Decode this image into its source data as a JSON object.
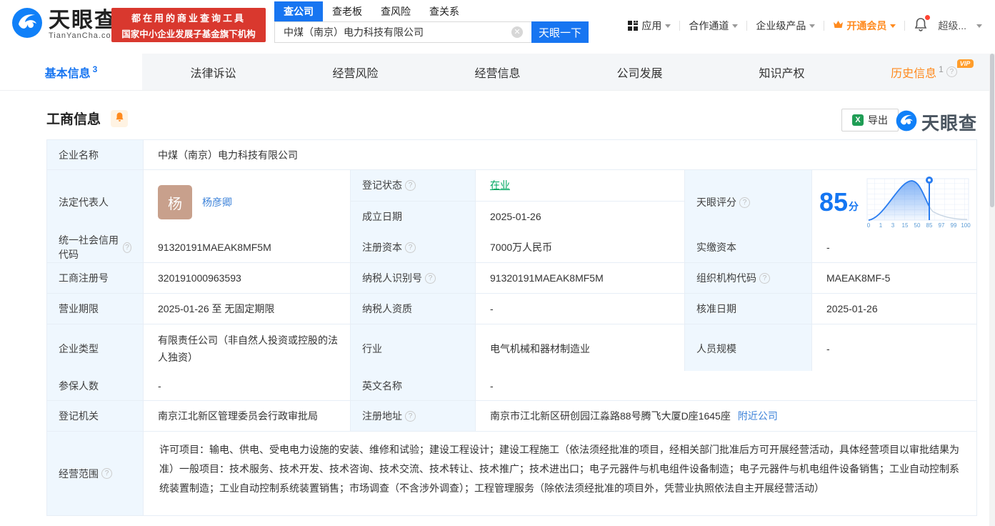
{
  "colors": {
    "accent": "#1775f1",
    "green": "#00a862",
    "orange": "#ff8a1e",
    "badge_red": "#d9382e"
  },
  "header": {
    "brand": {
      "name": "天眼查",
      "domain": "TianYanCha.com"
    },
    "badge": {
      "line1": "都在用的商业查询工具",
      "line2": "国家中小企业发展子基金旗下机构"
    },
    "search": {
      "tabs": [
        {
          "label": "查公司"
        },
        {
          "label": "查老板"
        },
        {
          "label": "查风险"
        },
        {
          "label": "查关系"
        }
      ],
      "input": "中煤（南京）电力科技有限公司",
      "button": "天眼一下"
    },
    "menu": {
      "apps": "应用",
      "partner": "合作通道",
      "enterprise": "企业级产品",
      "vip": "开通会员",
      "user": "超级..."
    }
  },
  "nav_tabs": [
    {
      "label": "基本信息",
      "count": "3"
    },
    {
      "label": "法律诉讼"
    },
    {
      "label": "经营风险"
    },
    {
      "label": "经营信息"
    },
    {
      "label": "公司发展"
    },
    {
      "label": "知识产权"
    },
    {
      "label": "历史信息",
      "count": "1",
      "badge": "VIP"
    }
  ],
  "section": {
    "title": "工商信息",
    "export": "导出",
    "watermark": "天眼查"
  },
  "score": {
    "label": "天眼评分",
    "value": "85",
    "unit": "分",
    "ticks": [
      "0",
      "1",
      "3",
      "15",
      "50",
      "85",
      "97",
      "99",
      "100"
    ]
  },
  "info": {
    "company_name": {
      "label": "企业名称",
      "value": "中煤（南京）电力科技有限公司"
    },
    "legal_rep": {
      "label": "法定代表人",
      "avatar_char": "杨",
      "name": "杨彦卿"
    },
    "reg_status": {
      "label": "登记状态",
      "value": "在业"
    },
    "establish_date": {
      "label": "成立日期",
      "value": "2025-01-26"
    },
    "credit_code": {
      "label": "统一社会信用代码",
      "value": "91320191MAEAK8MF5M"
    },
    "reg_capital": {
      "label": "注册资本",
      "value": "7000万人民币"
    },
    "paid_capital": {
      "label": "实缴资本",
      "value": "-"
    },
    "reg_number": {
      "label": "工商注册号",
      "value": "320191000963593"
    },
    "taxpayer_id": {
      "label": "纳税人识别号",
      "value": "91320191MAEAK8MF5M"
    },
    "org_code": {
      "label": "组织机构代码",
      "value": "MAEAK8MF-5"
    },
    "business_term": {
      "label": "营业期限",
      "value": "2025-01-26 至 无固定期限"
    },
    "taxpayer_quality": {
      "label": "纳税人资质",
      "value": "-"
    },
    "approve_date": {
      "label": "核准日期",
      "value": "2025-01-26"
    },
    "company_type": {
      "label": "企业类型",
      "value": "有限责任公司（非自然人投资或控股的法人独资）"
    },
    "industry": {
      "label": "行业",
      "value": "电气机械和器材制造业"
    },
    "staff_size": {
      "label": "人员规模",
      "value": "-"
    },
    "insured_count": {
      "label": "参保人数",
      "value": "-"
    },
    "english_name": {
      "label": "英文名称",
      "value": "-"
    },
    "reg_authority": {
      "label": "登记机关",
      "value": "南京江北新区管理委员会行政审批局"
    },
    "reg_address": {
      "label": "注册地址",
      "value": "南京市江北新区研创园江淼路88号腾飞大厦D座1645座",
      "link": "附近公司"
    },
    "business_scope": {
      "label": "经营范围",
      "value": "许可项目：输电、供电、受电电力设施的安装、维修和试验；建设工程设计；建设工程施工（依法须经批准的项目，经相关部门批准后方可开展经营活动，具体经营项目以审批结果为准）一般项目：技术服务、技术开发、技术咨询、技术交流、技术转让、技术推广；技术进出口；电子元器件与机电组件设备制造；电子元器件与机电组件设备销售；工业自动控制系统装置制造；工业自动控制系统装置销售；市场调查（不含涉外调查）；工程管理服务（除依法须经批准的项目外，凭营业执照依法自主开展经营活动）"
    }
  }
}
